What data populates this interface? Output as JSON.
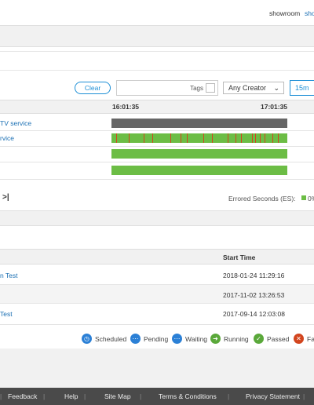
{
  "header": {
    "user": "showroom",
    "user_link": "sho"
  },
  "filters": {
    "clear_label": "Clear",
    "tags_label": "Tags",
    "creator_value": "Any Creator",
    "range_value": "15m"
  },
  "timeline": {
    "time_start": "16:01:35",
    "time_end": "17:01:35",
    "rows": [
      {
        "label": "TV service"
      },
      {
        "label": "rvice"
      },
      {
        "label": ""
      },
      {
        "label": ""
      }
    ]
  },
  "pager": {
    "last_icon": ">|",
    "errored_label": "Errored Seconds (ES):",
    "errored_value": "0%"
  },
  "table": {
    "col_start": "Start Time",
    "rows": [
      {
        "name": "n Test",
        "start": "2018-01-24 11:29:16"
      },
      {
        "name": "",
        "start": "2017-11-02 13:26:53"
      },
      {
        "name": "Test",
        "start": "2017-09-14 12:03:08"
      }
    ]
  },
  "legend": {
    "scheduled": "Scheduled",
    "pending": "Pending",
    "waiting": "Waiting",
    "running": "Running",
    "passed": "Passed",
    "failed": "Fa"
  },
  "footer": {
    "feedback": "Feedback",
    "help": "Help",
    "sitemap": "Site Map",
    "terms": "Terms & Conditions",
    "privacy": "Privacy Statement"
  },
  "colors": {
    "accent": "#1d8fd6",
    "ok": "#6cbd45",
    "error": "#d2451e",
    "unknown": "#666666"
  }
}
